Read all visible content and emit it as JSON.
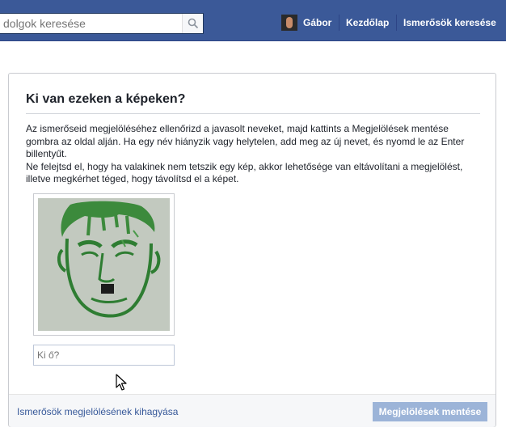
{
  "header": {
    "search_placeholder": "dolgok keresése",
    "user_name": "Gábor",
    "home_label": "Kezdőlap",
    "find_friends_label": "Ismerősök keresése",
    "bar_color": "#3b5998"
  },
  "dialog": {
    "title": "Ki van ezeken a képeken?",
    "paragraph_1": "Az ismerőseid megjelöléséhez ellenőrizd a javasolt neveket, majd kattints a Megjelölések mentése gombra az oldal alján. Ha egy név hiányzik vagy helytelen, add meg az új nevet, és nyomd le az Enter billentyűt.",
    "paragraph_2": "Ne felejtsd el, hogy ha valakinek nem tetszik egy kép, akkor lehetősége van eltávolítani a megjelölést, illetve megkérhet téged, hogy távolítsd el a képet.",
    "name_placeholder": "Ki ő?",
    "skip_link": "Ismerősök megjelölésének kihagyása",
    "save_button": "Megjelölések mentése",
    "save_button_color": "#9cb4d8"
  },
  "icons": {
    "search": "search-icon",
    "cursor": "mouse-pointer-icon"
  }
}
